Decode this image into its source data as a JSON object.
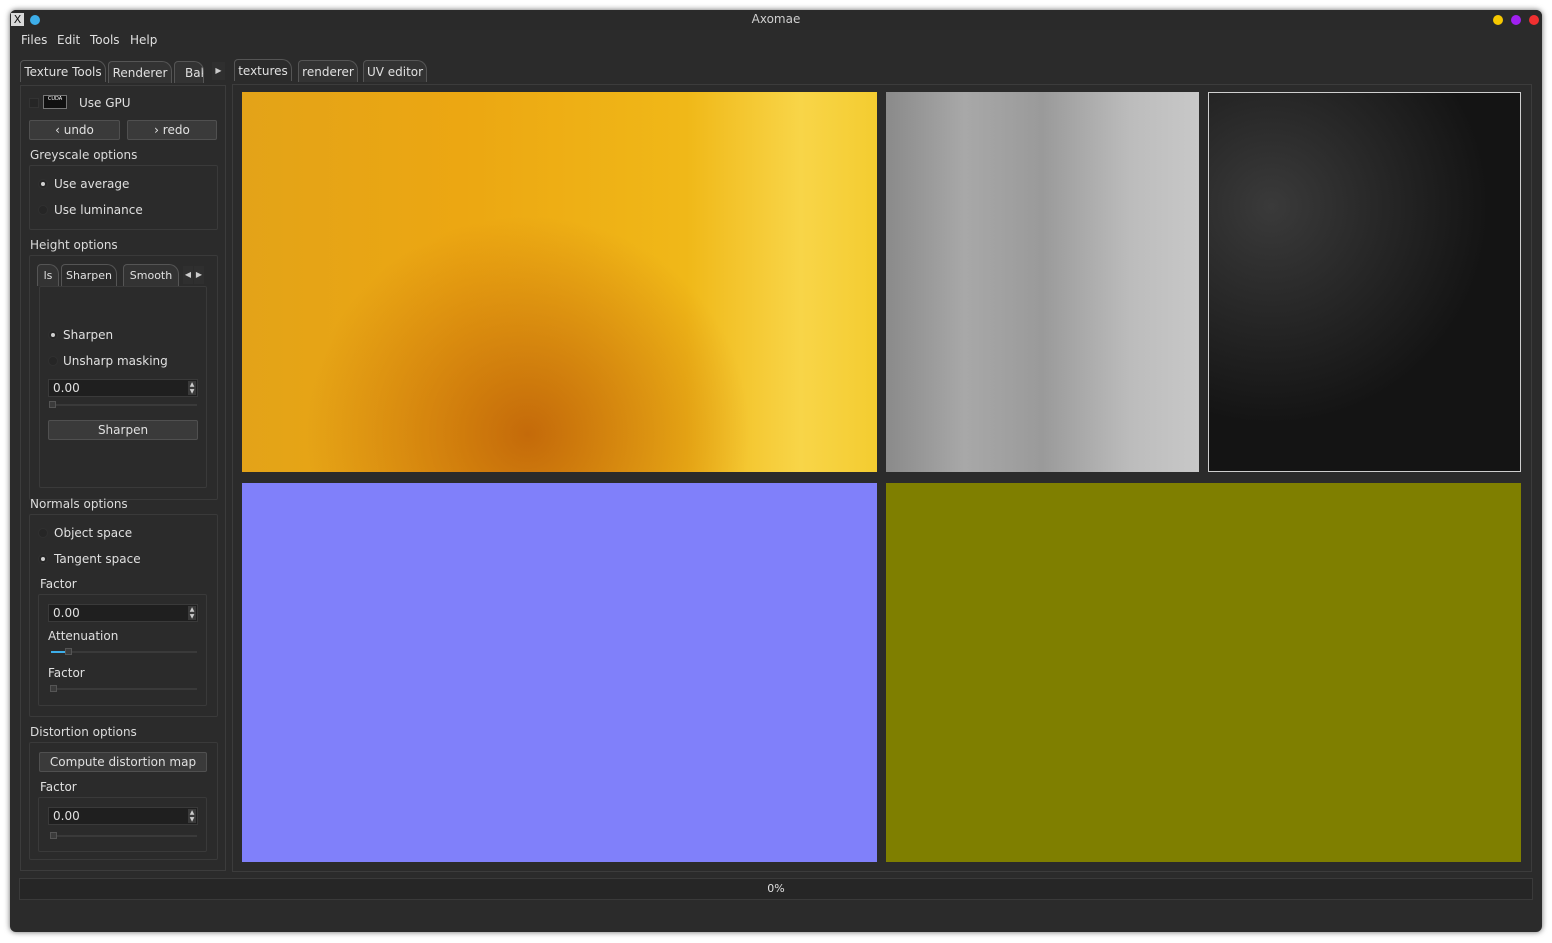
{
  "window": {
    "title": "Axomae"
  },
  "menu": {
    "files": "Files",
    "edit": "Edit",
    "tools": "Tools",
    "help": "Help"
  },
  "left_tabs": [
    "Texture Tools",
    "Renderer",
    "Bak"
  ],
  "right_tabs": [
    "textures",
    "renderer",
    "UV editor"
  ],
  "gpu": {
    "label": "Use GPU",
    "icon_text": "CUDA"
  },
  "history": {
    "undo": "undo",
    "redo": "redo"
  },
  "greyscale": {
    "title": "Greyscale options",
    "avg": "Use average",
    "lum": "Use luminance"
  },
  "height": {
    "title": "Height options",
    "tabs": [
      "ls",
      "Sharpen",
      "Smooth"
    ],
    "sharpen_radio": "Sharpen",
    "unsharp_radio": "Unsharp masking",
    "value": "0.00",
    "button": "Sharpen"
  },
  "normals": {
    "title": "Normals options",
    "object": "Object space",
    "tangent": "Tangent space",
    "factor_label": "Factor",
    "factor_value": "0.00",
    "attenuation_label": "Attenuation",
    "factor2_label": "Factor"
  },
  "distortion": {
    "title": "Distortion options",
    "button": "Compute distortion map",
    "factor_label": "Factor",
    "factor_value": "0.00"
  },
  "progress": {
    "text": "0%",
    "value": 0
  },
  "colors": {
    "titlebar_yellow": "#f6c800",
    "titlebar_purple": "#a020f0",
    "titlebar_red": "#f03030",
    "normal_map": "#8080fa",
    "distortion_map": "#7f7f00"
  }
}
